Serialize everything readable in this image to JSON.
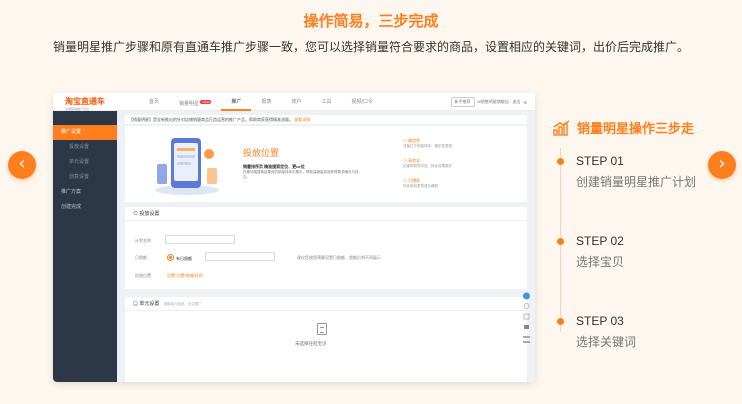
{
  "headline": "操作简易，三步完成",
  "subline": "销量明星推广步骤和原有直通车推广步骤一致，您可以选择销量符合要求的商品，设置相应的关键词，出价后完成推广。",
  "colors": {
    "accent": "#ff7f1e",
    "background": "#fdf7ef",
    "sidebar": "#2c3748"
  },
  "icons": {
    "prev": "chevron-left-icon",
    "next": "chevron-right-icon",
    "steps": "bar-chart-growth-icon"
  },
  "screen": {
    "logo": "淘宝直通车",
    "logo_sub": "全域营销推广平台",
    "nav": [
      "首页",
      "销量明星",
      "推广",
      "报表",
      "账户",
      "工具",
      "视频/口令"
    ],
    "nav_badge": "NEW",
    "account_button": "新手推荐",
    "account_text": "tb销售明星旗舰店 · 退出",
    "sidebar": [
      {
        "label": "推广设置",
        "active": true,
        "sub": false
      },
      {
        "label": "投放设置",
        "active": false,
        "sub": true
      },
      {
        "label": "单元设置",
        "active": false,
        "sub": true
      },
      {
        "label": "创意设置",
        "active": false,
        "sub": true
      },
      {
        "label": "推广方案",
        "active": false,
        "sub": false
      },
      {
        "label": "创建完成",
        "active": false,
        "sub": false
      }
    ],
    "notice": "【销量明星】是全新推出的针对店铺销量商品打造运营的推广产品，帮助商家获得精准流量。",
    "notice_link": "查看详情",
    "hero_title": "投放位置",
    "hero_desc_title": "销量排序页 精准搜索定位、更ue位",
    "hero_desc": "在移动端搜索结果页的销量排序中展示，帮助高销量商品获得更多曝光与成交。",
    "features": [
      {
        "title": "确定性",
        "desc": "流量位于销量排序，确定性更强"
      },
      {
        "title": "高转化",
        "desc": "买家购物意向强，转化效果更好"
      },
      {
        "title": "打爆款",
        "desc": "热卖商品更易成为爆款"
      }
    ],
    "delivery_panel_title": "投放设置",
    "form_name_label": "计划名称",
    "form_budget_label": "日限额",
    "form_budget_option": "有日限额",
    "form_budget_hint": "建议您按照预算设置日限额，超额后将不再展示",
    "form_place_label": "投放位置",
    "form_place_link": "设置“位置/地域/时间”",
    "unit_panel_title": "单元设置",
    "unit_panel_sub": "选取单元商品，设立推广",
    "empty_text": "未选择任何宝贝"
  },
  "side_title": "销量明星操作三步走",
  "steps": [
    {
      "num": "STEP 01",
      "desc": "创建销量明星推广计划"
    },
    {
      "num": "STEP 02",
      "desc": "选择宝贝"
    },
    {
      "num": "STEP 03",
      "desc": "选择关键词"
    }
  ]
}
